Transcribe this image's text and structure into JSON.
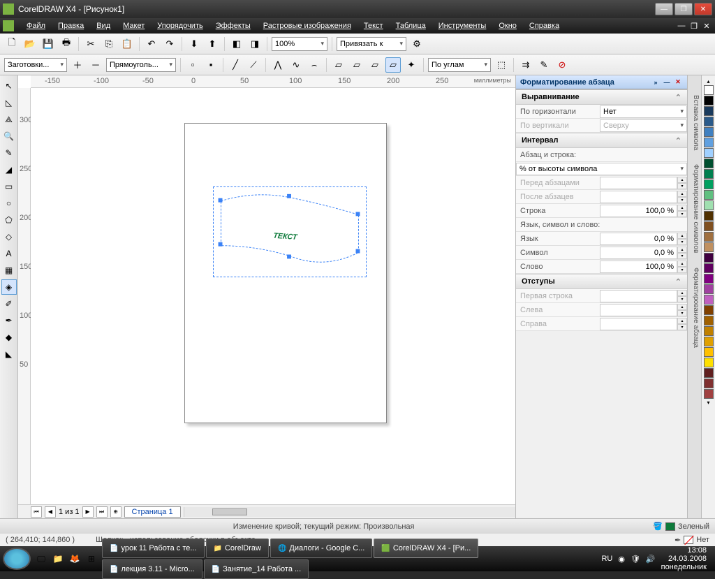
{
  "title": "CorelDRAW X4 - [Рисунок1]",
  "menu": [
    "Файл",
    "Правка",
    "Вид",
    "Макет",
    "Упорядочить",
    "Эффекты",
    "Растровые изображения",
    "Текст",
    "Таблица",
    "Инструменты",
    "Окно",
    "Справка"
  ],
  "toolbar2": {
    "zoom": "100%",
    "snap": "Привязать к"
  },
  "propbar": {
    "preset": "Заготовки...",
    "shape": "Прямоуголь...",
    "snap": "По углам"
  },
  "ruler_units": "миллиметры",
  "ruler_h": [
    "-150",
    "-100",
    "-50",
    "0",
    "50",
    "100",
    "150",
    "200",
    "250"
  ],
  "ruler_v": [
    "300",
    "250",
    "200",
    "150",
    "100",
    "50"
  ],
  "canvas_text": "ТЕКСТ",
  "page_nav": {
    "count": "1 из 1",
    "tab": "Страница 1"
  },
  "docker": {
    "title": "Форматирование абзаца",
    "sec1": "Выравнивание",
    "h_label": "По горизонтали",
    "h_val": "Нет",
    "v_label": "По вертикали",
    "v_val": "Сверху",
    "sec2": "Интервал",
    "para_line": "Абзац и строка:",
    "unit": "% от высоты символа",
    "before": "Перед абзацами",
    "after": "После абзацев",
    "line": "Строка",
    "line_val": "100,0 %",
    "lang_hdr": "Язык, символ и слово:",
    "lang": "Язык",
    "lang_val": "0,0 %",
    "char": "Символ",
    "char_val": "0,0 %",
    "word": "Слово",
    "word_val": "100,0 %",
    "sec3": "Отступы",
    "first": "Первая строка",
    "left": "Слева",
    "right": "Справа"
  },
  "vtabs": [
    "Вставка символа",
    "Форматирование символов",
    "Форматирование абзаца"
  ],
  "status": {
    "coords": "( 264,410; 144,860 )",
    "hint": "Щелчок - использование оболочки в объекте",
    "mode": "Изменение кривой; текущий режим: Произвольная",
    "fill": "Зеленый",
    "outline": "Нет"
  },
  "taskbar": {
    "items": [
      "урок 11 Работа с те...",
      "CorelDraw",
      "Диалоги - Google C...",
      "CorelDRAW X4 - [Ри...",
      "лекция 3.11 - Micro...",
      "Занятие_14 Работа ..."
    ],
    "lang": "RU",
    "time": "13:08",
    "date": "24.03.2008",
    "day": "понедельник"
  },
  "palette": [
    "#ffffff",
    "#000000",
    "#1a3a5c",
    "#2a5a8a",
    "#4080c0",
    "#60a0e0",
    "#a0d0ff",
    "#005030",
    "#008050",
    "#00a060",
    "#60c080",
    "#a0e0b0",
    "#503000",
    "#805020",
    "#a07040",
    "#c09060",
    "#400040",
    "#600060",
    "#800080",
    "#a040a0",
    "#c060c0",
    "#804000",
    "#a06000",
    "#c08000",
    "#e0a000",
    "#ffc000",
    "#ffe000",
    "#602020",
    "#803030",
    "#a04040"
  ]
}
